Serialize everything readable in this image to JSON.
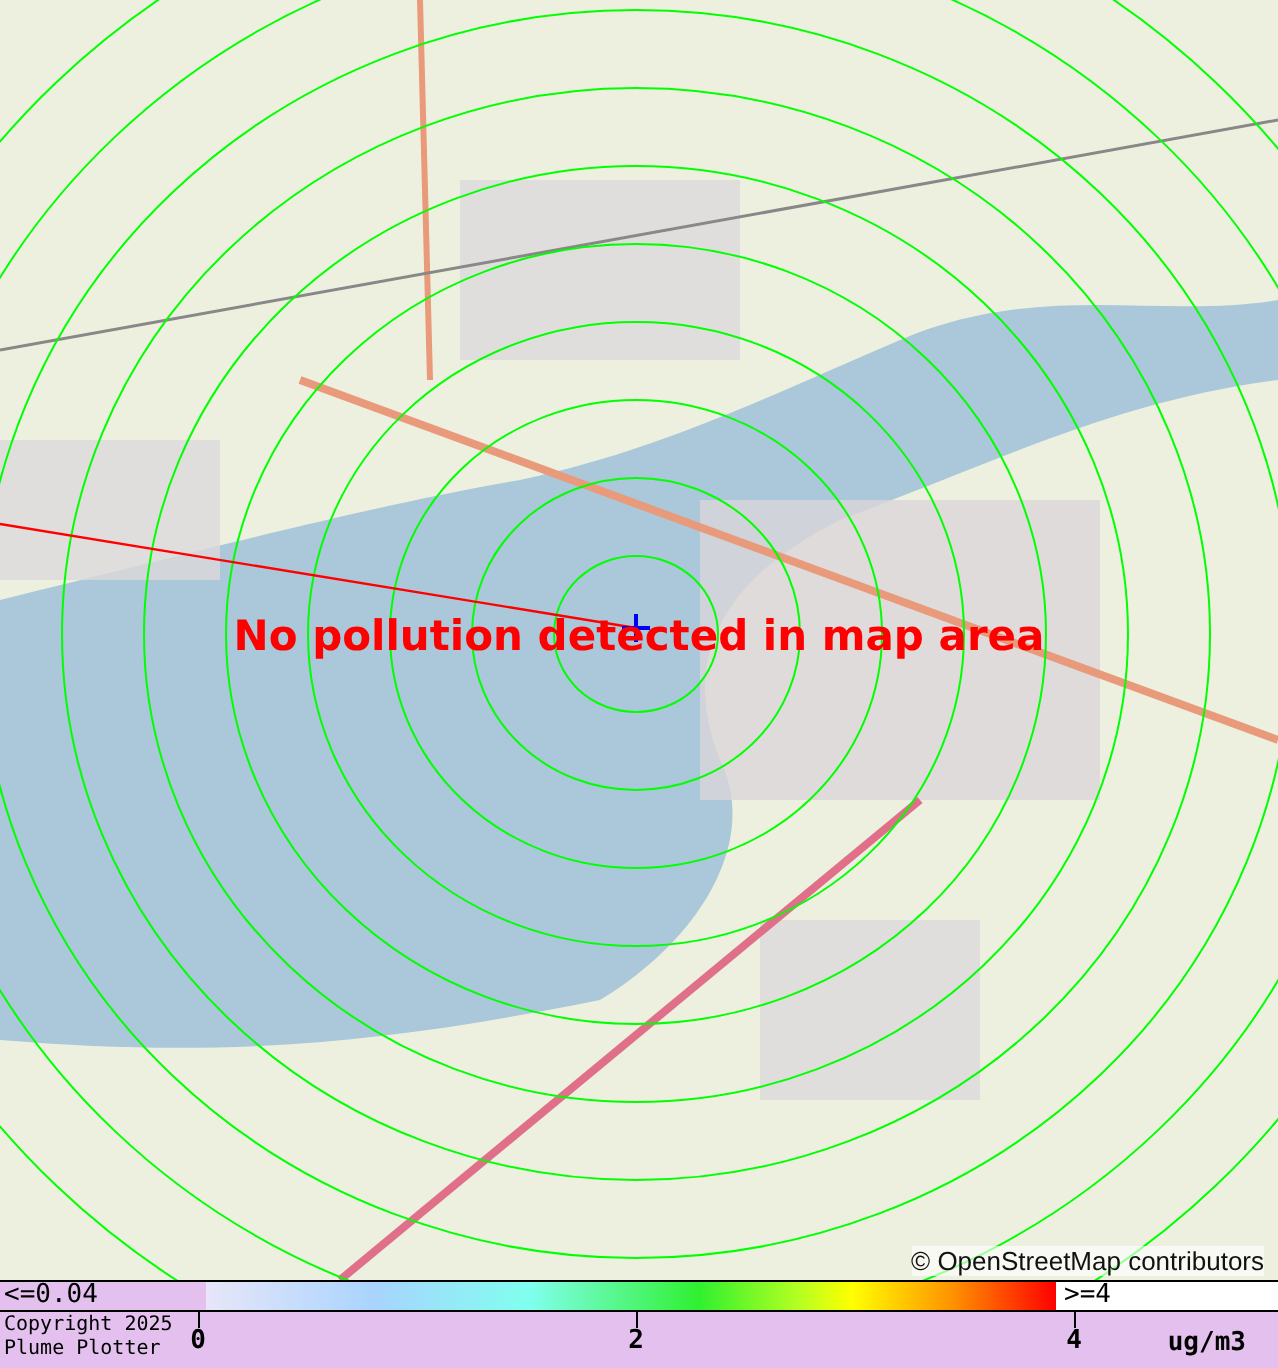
{
  "map": {
    "message": "No pollution detected in map area",
    "attribution": "© OpenStreetMap contributors"
  },
  "legend": {
    "low_label": "<=0.04",
    "high_label": ">=4",
    "ticks": [
      "0",
      "2",
      "4"
    ],
    "unit": "ug/m3"
  },
  "footer": {
    "copyright": [
      "Copyright 2025",
      "Plume Plotter"
    ]
  }
}
